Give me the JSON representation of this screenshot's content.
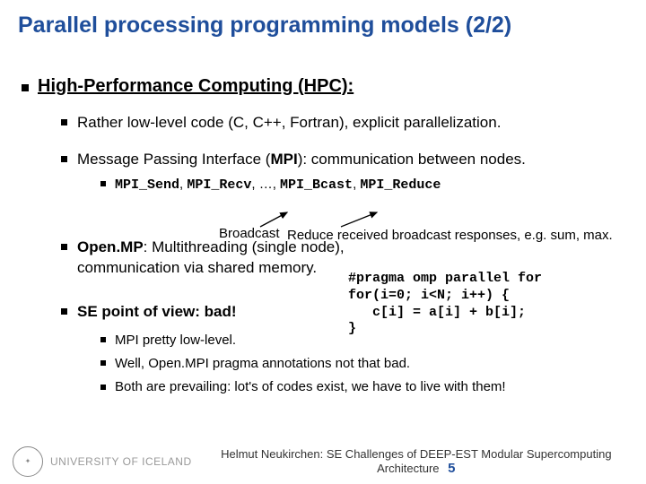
{
  "title": "Parallel processing programming models (2/2)",
  "section": {
    "heading": "High-Performance Computing (HPC):"
  },
  "b1": {
    "text": "Rather low-level code (C, C++, Fortran), explicit parallelization."
  },
  "b2": {
    "prefix": "Message Passing Interface (",
    "mpi": "MPI",
    "suffix": "): communication between nodes.",
    "codes": {
      "c1": "MPI_Send",
      "c2": "MPI_Recv",
      "dots": ", …, ",
      "c3": "MPI_Bcast",
      "c4": "MPI_Reduce"
    }
  },
  "anno": {
    "broadcast": "Broadcast",
    "reduce": "Reduce received broadcast responses, e.g. sum, max."
  },
  "b3": {
    "strong": "Open.MP",
    "rest1": ": Multithreading (single node),",
    "rest2": "communication via shared memory."
  },
  "code_block": "#pragma omp parallel for\nfor(i=0; i<N; i++) {\n   c[i] = a[i] + b[i];\n}",
  "b4": {
    "text": "SE point of view: bad!"
  },
  "sub": {
    "s1": "MPI pretty low-level.",
    "s2": "Well, Open.MPI pragma annotations not that bad.",
    "s3": "Both are prevailing: lot's of codes exist, we have to live with them!"
  },
  "footer": {
    "uni": "UNIVERSITY OF ICELAND",
    "text": "Helmut Neukirchen: SE Challenges of DEEP-EST Modular Supercomputing Architecture",
    "page": "5"
  }
}
